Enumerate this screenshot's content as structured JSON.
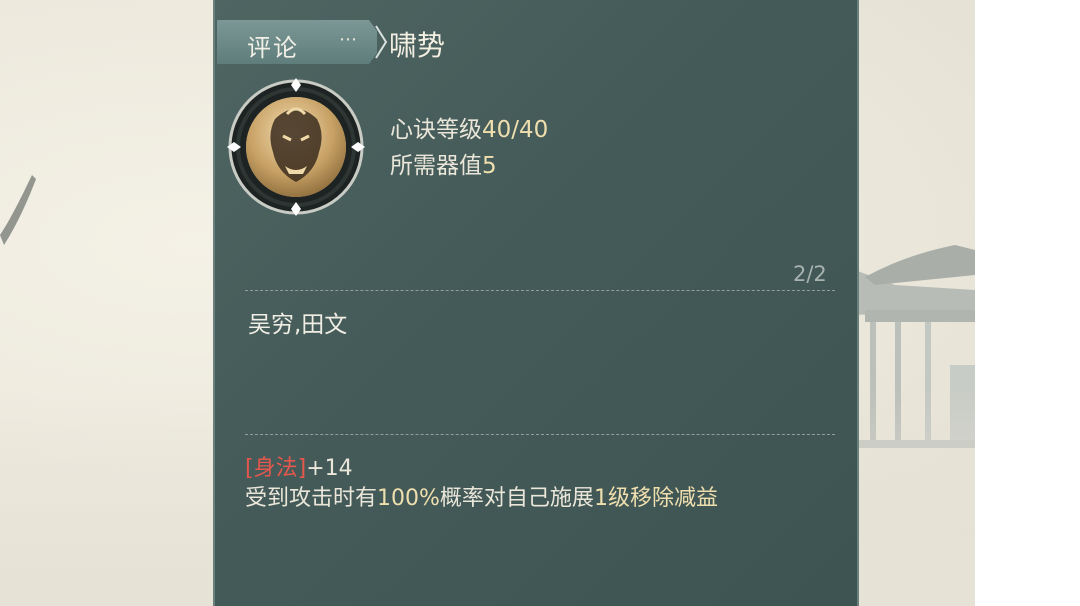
{
  "tab": {
    "comment_label": "评论",
    "more_glyph": "⋯"
  },
  "skill": {
    "name": "啸势",
    "level_label": "心诀等级",
    "level_value": "40/40",
    "cost_label": "所需器值",
    "cost_value": "5"
  },
  "pager": {
    "text": "2/2"
  },
  "owners": "吴穷,田文",
  "bonus": {
    "attr_open": "[",
    "attr_name": "身法",
    "attr_close": "]",
    "attr_value": "+14",
    "effect_pre": "受到攻击时有",
    "effect_chance": "100%",
    "effect_mid": "概率对自己施展",
    "effect_level": "1",
    "effect_post": "级移除减益"
  },
  "colors": {
    "panel": "#455b59",
    "highlight": "#efdfae",
    "attribute": "#e4574d",
    "text": "#eae6da"
  },
  "icons": {
    "emblem": "tiger-emblem-icon",
    "chevron": "chevron-right-icon",
    "more": "ellipsis-icon"
  }
}
